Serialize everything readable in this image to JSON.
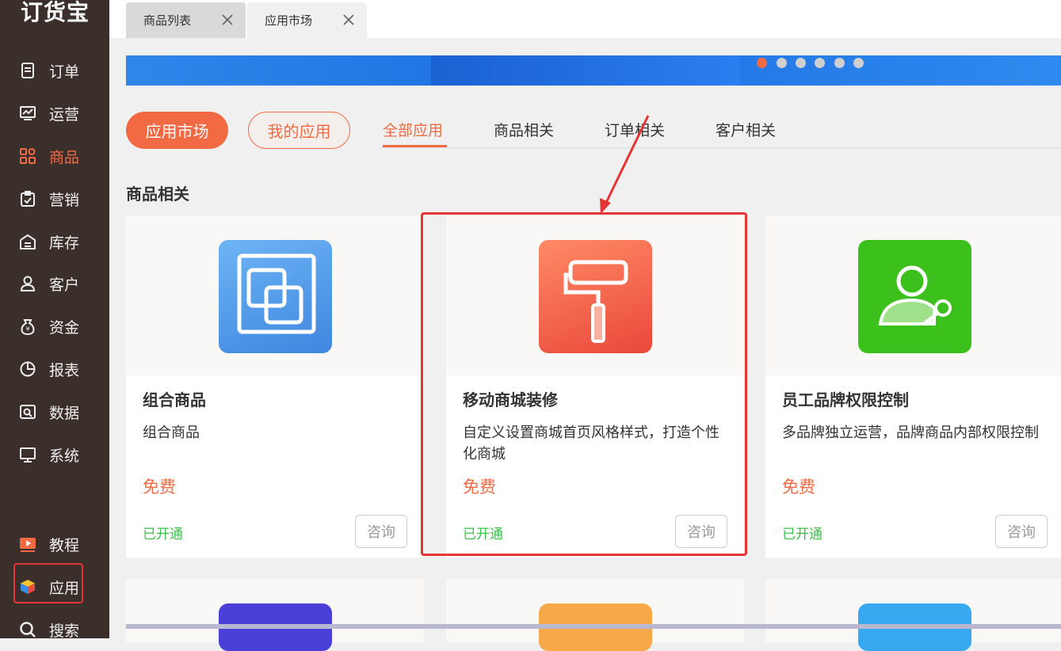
{
  "logo": "订货宝",
  "nav": [
    {
      "label": "订单",
      "icon": "order-icon"
    },
    {
      "label": "运营",
      "icon": "operation-icon"
    },
    {
      "label": "商品",
      "icon": "goods-icon"
    },
    {
      "label": "营销",
      "icon": "marketing-icon"
    },
    {
      "label": "库存",
      "icon": "inventory-icon"
    },
    {
      "label": "客户",
      "icon": "customer-icon"
    },
    {
      "label": "资金",
      "icon": "funds-icon"
    },
    {
      "label": "报表",
      "icon": "report-icon"
    },
    {
      "label": "数据",
      "icon": "data-icon"
    },
    {
      "label": "系统",
      "icon": "system-icon"
    }
  ],
  "bottom_nav": [
    {
      "label": "教程",
      "icon": "tutorial-icon"
    },
    {
      "label": "应用",
      "icon": "apps-icon"
    },
    {
      "label": "搜索",
      "icon": "search-icon"
    }
  ],
  "tabs": [
    {
      "label": "商品列表"
    },
    {
      "label": "应用市场"
    }
  ],
  "pills": {
    "market": "应用市场",
    "mine": "我的应用"
  },
  "categories": [
    "全部应用",
    "商品相关",
    "订单相关",
    "客户相关"
  ],
  "section_title": "商品相关",
  "cards": [
    {
      "title": "组合商品",
      "desc": "组合商品",
      "price": "免费",
      "status": "已开通",
      "button": "咨询",
      "icon": "combo-goods-icon",
      "color": "#4a90e8"
    },
    {
      "title": "移动商城装修",
      "desc": "自定义设置商城首页风格样式，打造个性化商城",
      "price": "免费",
      "status": "已开通",
      "button": "咨询",
      "icon": "paint-roller-icon",
      "color": "#f05a3c"
    },
    {
      "title": "员工品牌权限控制",
      "desc": "多品牌独立运营，品牌商品内部权限控制",
      "price": "免费",
      "status": "已开通",
      "button": "咨询",
      "icon": "user-key-icon",
      "color": "#3cc11c"
    }
  ],
  "colors": {
    "accent": "#f26a44",
    "sidebar": "#3a2f2b",
    "success": "#3bbf4a",
    "highlight": "#e53535"
  }
}
